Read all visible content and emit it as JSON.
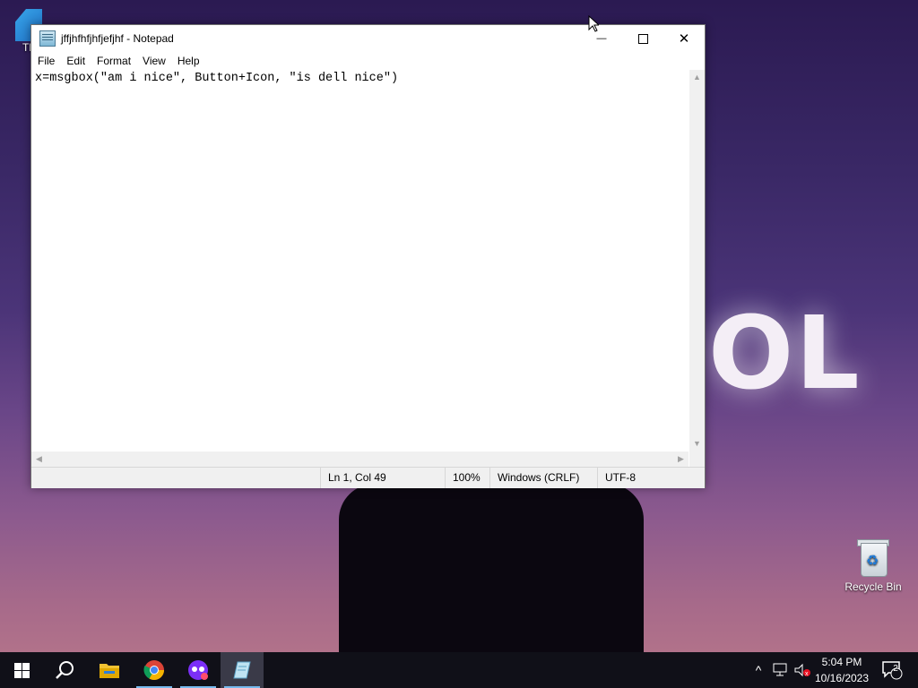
{
  "desktop": {
    "pc_icon_label": "Th",
    "recycle_bin_label": "Recycle Bin",
    "wallpaper_text": "OL"
  },
  "notepad": {
    "title": "jffjhfhfjhfjefjhf - Notepad",
    "menu": [
      "File",
      "Edit",
      "Format",
      "View",
      "Help"
    ],
    "content": "x=msgbox(\"am i nice\", Button+Icon, \"is dell nice\")",
    "status": {
      "position": "Ln 1, Col 49",
      "zoom": "100%",
      "line_ending": "Windows (CRLF)",
      "encoding": "UTF-8"
    },
    "controls": {
      "minimize": "—",
      "maximize": "☐",
      "close": "✕"
    }
  },
  "taskbar": {
    "start_icon": "windows-logo-icon",
    "search_icon": "search-icon",
    "pinned": [
      "file-explorer-icon",
      "chrome-icon",
      "app-mask-icon",
      "notepad-icon"
    ],
    "tray": {
      "chevron": "^",
      "notification_count": "2"
    },
    "clock": {
      "time": "5:04 PM",
      "date": "10/16/2023"
    }
  },
  "colors": {
    "taskbar_bg": "#101018",
    "active_underline": "#76b9ed"
  }
}
